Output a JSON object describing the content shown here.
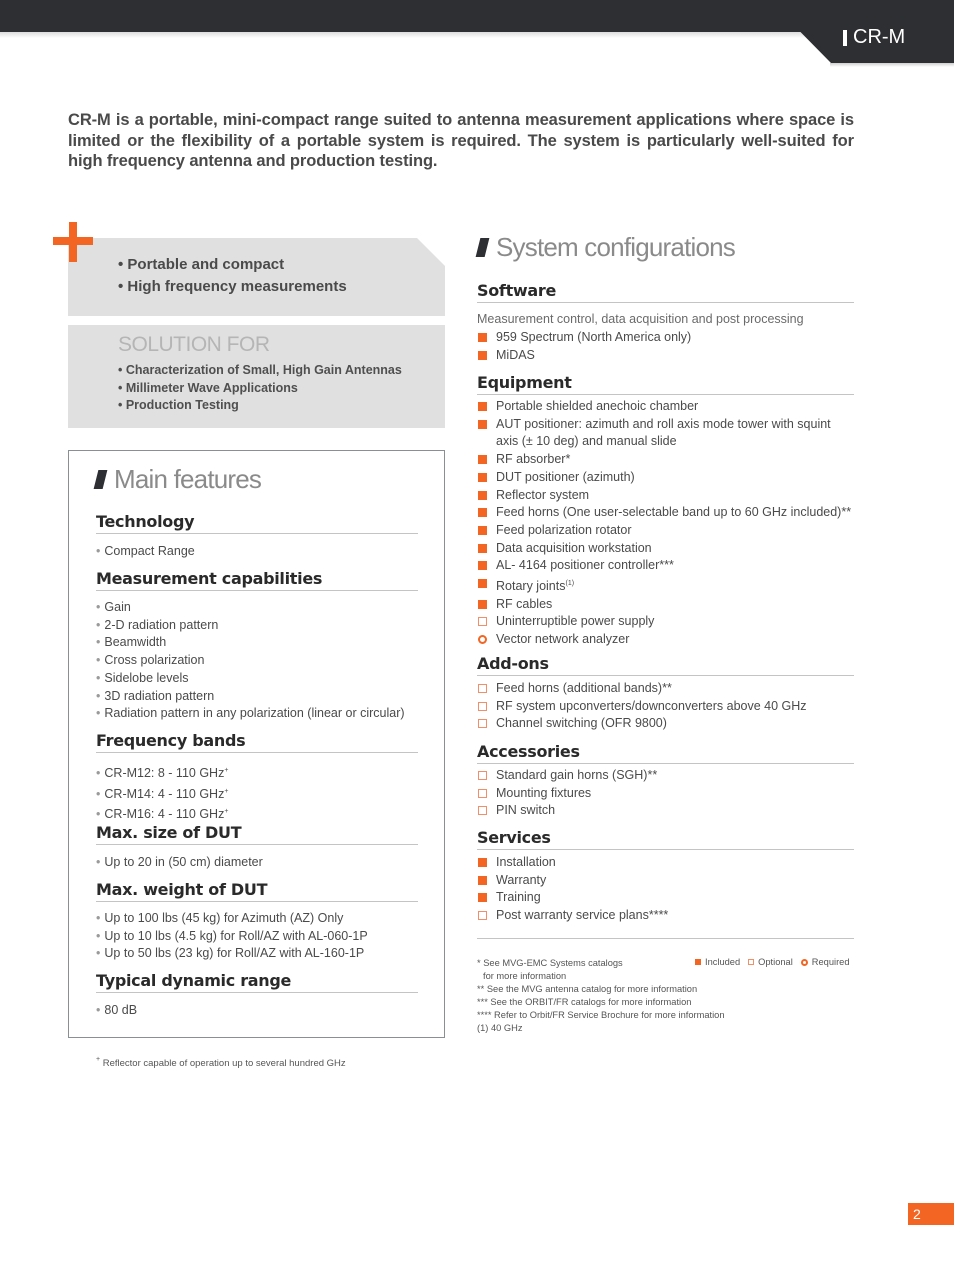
{
  "header": {
    "tab_label": "CR-M"
  },
  "intro": "CR-M is a portable, mini-compact range suited to antenna measurement applications where space is limited or the flexibility of a portable system is required. The system is particularly well-suited for high frequency antenna and production testing.",
  "highlights": [
    "• Portable and compact",
    "• High frequency measurements"
  ],
  "solution_for": {
    "title": "SOLUTION FOR",
    "items": [
      "•  Characterization of Small, High Gain Antennas",
      "•  Millimeter Wave Applications",
      "•  Production Testing"
    ]
  },
  "main_features": {
    "title": "Main features",
    "sections": [
      {
        "heading": "Technology",
        "items": [
          "Compact Range"
        ]
      },
      {
        "heading": "Measurement capabilities",
        "items": [
          "Gain",
          "2-D radiation pattern",
          "Beamwidth",
          "Cross polarization",
          "Sidelobe levels",
          "3D radiation pattern",
          "Radiation pattern in any polarization (linear or circular)"
        ]
      },
      {
        "heading": "Frequency bands",
        "items": [
          "CR-M12: 8 - 110 GHz",
          "CR-M14: 4 - 110 GHz",
          "CR-M16: 4 - 110 GHz"
        ],
        "item_sup": "+"
      },
      {
        "heading": "Max. size of DUT",
        "items": [
          "Up to 20 in (50 cm) diameter"
        ]
      },
      {
        "heading": "Max. weight of DUT",
        "items": [
          "Up to 100 lbs (45 kg) for Azimuth (AZ) Only",
          "Up to 10 lbs (4.5 kg) for Roll/AZ with AL-060-1P",
          "Up to 50 lbs (23 kg) for Roll/AZ with AL-160-1P"
        ]
      },
      {
        "heading": "Typical dynamic range",
        "items": [
          "80 dB"
        ]
      }
    ],
    "footnote_sup": "+",
    "footnote": " Reflector capable of operation up to several hundred GHz"
  },
  "system_configurations": {
    "title": "System configurations",
    "software": {
      "heading": "Software",
      "description": "Measurement control, data acquisition and post processing",
      "items": [
        {
          "label": "959 Spectrum (North America only)",
          "status": "included"
        },
        {
          "label": "MiDAS",
          "status": "included"
        }
      ]
    },
    "equipment": {
      "heading": "Equipment",
      "items": [
        {
          "label": "Portable shielded anechoic chamber",
          "status": "included"
        },
        {
          "label": "AUT positioner: azimuth and roll axis mode tower with squint axis (± 10 deg) and manual slide",
          "status": "included"
        },
        {
          "label": "RF absorber*",
          "status": "included"
        },
        {
          "label": "DUT positioner (azimuth)",
          "status": "included"
        },
        {
          "label": "Reflector system",
          "status": "included"
        },
        {
          "label": "Feed horns (One user-selectable band up to 60 GHz included)**",
          "status": "included"
        },
        {
          "label": "Feed polarization rotator",
          "status": "included"
        },
        {
          "label": "Data acquisition workstation",
          "status": "included"
        },
        {
          "label": "AL- 4164 positioner controller***",
          "status": "included"
        },
        {
          "label": "Rotary joints",
          "sup": "(1)",
          "status": "included"
        },
        {
          "label": "RF cables",
          "status": "included"
        },
        {
          "label": "Uninterruptible power supply",
          "status": "optional"
        },
        {
          "label": "Vector network analyzer",
          "status": "required"
        }
      ]
    },
    "addons": {
      "heading": "Add-ons",
      "items": [
        {
          "label": "Feed horns (additional bands)**",
          "status": "optional"
        },
        {
          "label": "RF system upconverters/downconverters above 40 GHz",
          "status": "optional"
        },
        {
          "label": "Channel switching (OFR 9800)",
          "status": "optional"
        }
      ]
    },
    "accessories": {
      "heading": "Accessories",
      "items": [
        {
          "label": "Standard gain horns (SGH)**",
          "status": "optional"
        },
        {
          "label": "Mounting fixtures",
          "status": "optional"
        },
        {
          "label": "PIN switch",
          "status": "optional"
        }
      ]
    },
    "services": {
      "heading": "Services",
      "items": [
        {
          "label": "Installation",
          "status": "included"
        },
        {
          "label": "Warranty",
          "status": "included"
        },
        {
          "label": "Training",
          "status": "included"
        },
        {
          "label": "Post warranty service plans****",
          "status": "optional"
        }
      ]
    },
    "notes": [
      "* See MVG-EMC Systems catalogs",
      "  for more information",
      "** See the MVG antenna catalog for more information",
      "*** See the ORBIT/FR catalogs for more information",
      "**** Refer to Orbit/FR Service Brochure for more information",
      "(1) 40 GHz"
    ],
    "legend": {
      "included": "Included",
      "optional": "Optional",
      "required": "Required"
    }
  },
  "colors": {
    "accent": "#f26522",
    "dark": "#2e2f33",
    "panel": "#e0e0e0"
  },
  "page_number": "2"
}
